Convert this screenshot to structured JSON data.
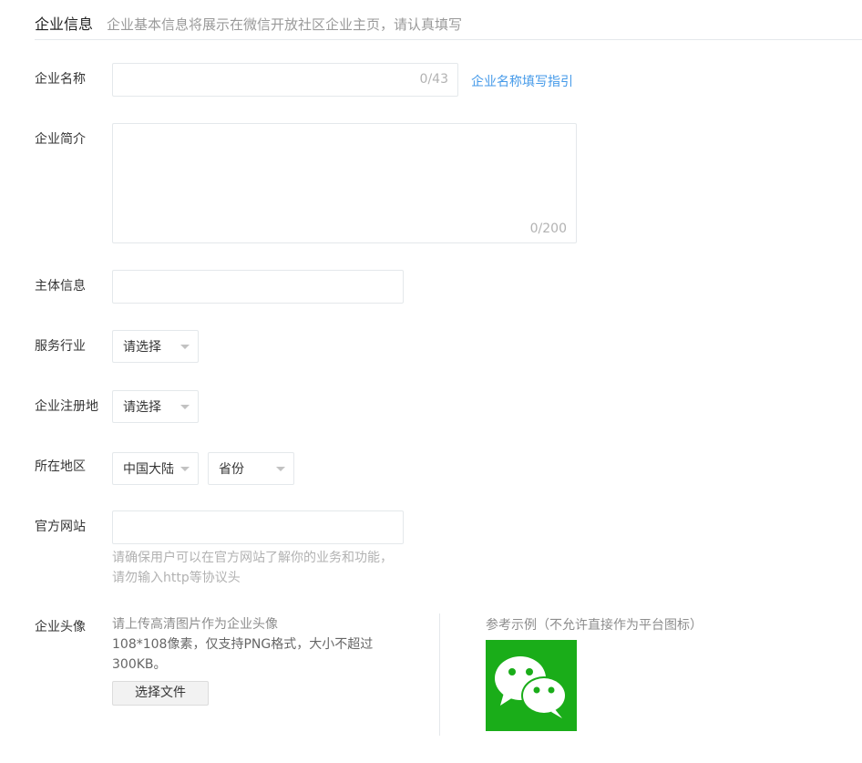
{
  "header": {
    "title": "企业信息",
    "description": "企业基本信息将展示在微信开放社区企业主页，请认真填写"
  },
  "fields": {
    "name": {
      "label": "企业名称",
      "value": "",
      "counter": "0/43",
      "guide_link": "企业名称填写指引"
    },
    "intro": {
      "label": "企业简介",
      "value": "",
      "counter": "0/200"
    },
    "entity": {
      "label": "主体信息",
      "value": ""
    },
    "industry": {
      "label": "服务行业",
      "selected": "请选择"
    },
    "reg_place": {
      "label": "企业注册地",
      "selected": "请选择"
    },
    "region": {
      "label": "所在地区",
      "country": "中国大陆",
      "province": "省份"
    },
    "website": {
      "label": "官方网站",
      "value": "",
      "hint_line1": "请确保用户可以在官方网站了解你的业务和功能，",
      "hint_line2": "请勿输入http等协议头"
    },
    "avatar": {
      "label": "企业头像",
      "desc_line1": "请上传高清图片作为企业头像",
      "desc_line2": "108*108像素，仅支持PNG格式，大小不超过",
      "desc_line3": "300KB。",
      "button": "选择文件",
      "example_label": "参考示例（不允许直接作为平台图标）"
    }
  },
  "colors": {
    "link": "#459ae9",
    "wechat_green": "#1aad19",
    "border": "#e4e8eb"
  }
}
